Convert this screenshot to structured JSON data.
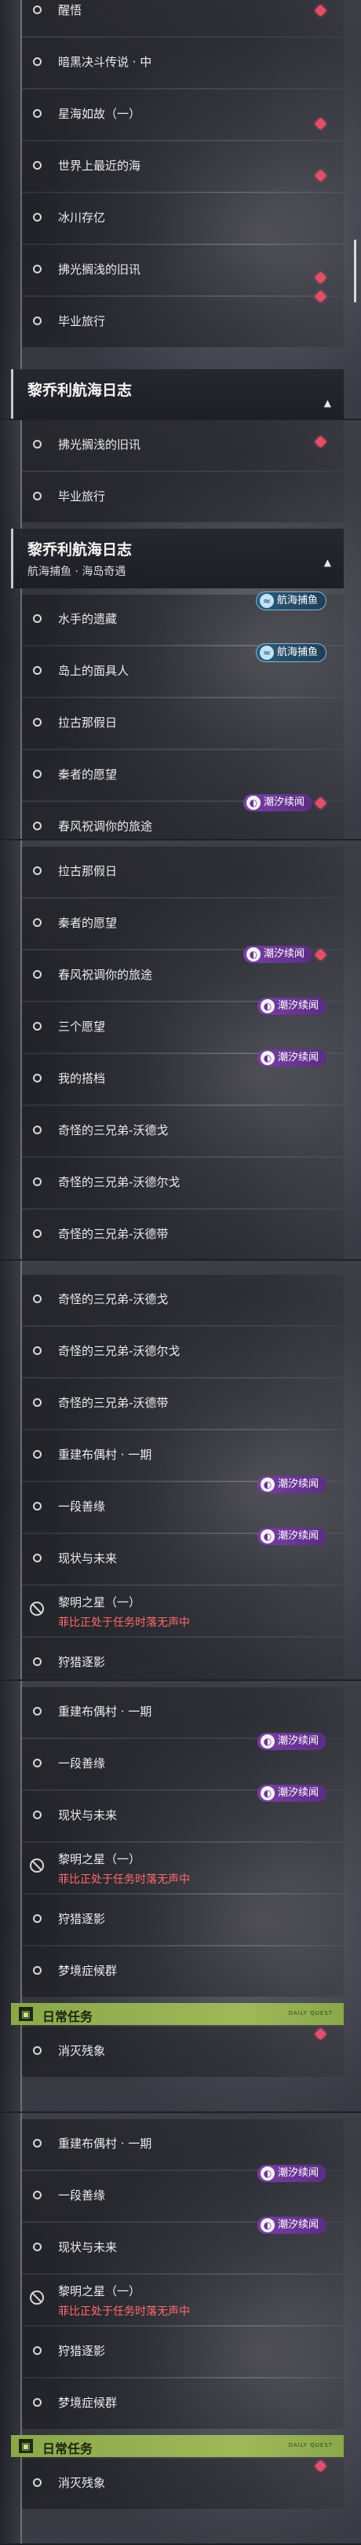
{
  "s1": {
    "items": [
      {
        "label": "醒悟",
        "dot": true
      },
      {
        "label": "暗黑决斗传说 · 中",
        "dot": false
      },
      {
        "label": "星海如故（一）",
        "dot": true
      },
      {
        "label": "世界上最近的海",
        "dot": true
      },
      {
        "label": "冰川存亿",
        "dot": false
      },
      {
        "label": "拂光搁浅的旧讯",
        "dot": true
      },
      {
        "label": "毕业旅行",
        "dot": false
      }
    ],
    "header": {
      "title": "黎乔利航海日志"
    }
  },
  "s2": {
    "items": [
      {
        "label": "拂光搁浅的旧讯",
        "dot": true
      },
      {
        "label": "毕业旅行",
        "dot": false
      }
    ],
    "header": {
      "title": "黎乔利航海日志",
      "sub": "航海捕鱼 · 海岛奇遇"
    },
    "items2": [
      {
        "label": "水手的遗藏",
        "tag": "航海捕鱼"
      },
      {
        "label": "岛上的面具人",
        "tag": "航海捕鱼"
      },
      {
        "label": "拉古那假日"
      },
      {
        "label": "秦者的愿望"
      },
      {
        "label": "春风祝调你的旅途",
        "tag": "潮汐续闻",
        "dot": true
      }
    ]
  },
  "s3": {
    "items": [
      {
        "label": "拉古那假日"
      },
      {
        "label": "秦者的愿望"
      },
      {
        "label": "春风祝调你的旅途",
        "tag": "潮汐续闻",
        "dot": true
      },
      {
        "label": "三个愿望",
        "tag": "潮汐续闻"
      },
      {
        "label": "我的搭档",
        "tag": "潮汐续闻"
      },
      {
        "label": "奇怪的三兄弟-沃德戈"
      },
      {
        "label": "奇怪的三兄弟-沃德尔戈"
      },
      {
        "label": "奇怪的三兄弟-沃德带"
      }
    ]
  },
  "s4": {
    "items": [
      {
        "label": "奇怪的三兄弟-沃德戈"
      },
      {
        "label": "奇怪的三兄弟-沃德尔戈"
      },
      {
        "label": "奇怪的三兄弟-沃德带"
      },
      {
        "label": "重建布偶村 · 一期"
      },
      {
        "label": "一段善缘",
        "tag": "潮汐续闻"
      },
      {
        "label": "现状与未来",
        "tag": "潮汐续闻"
      },
      {
        "label": "黎明之星（一）",
        "sub": "菲比正处于任务时落无声中"
      },
      {
        "label": "狩猎逐影"
      }
    ]
  },
  "s5": {
    "items": [
      {
        "label": "重建布偶村 · 一期"
      },
      {
        "label": "一段善缘",
        "tag": "潮汐续闻"
      },
      {
        "label": "现状与未来",
        "tag": "潮汐续闻"
      },
      {
        "label": "黎明之星（一）",
        "sub": "菲比正处于任务时落无声中"
      },
      {
        "label": "狩猎逐影"
      },
      {
        "label": "梦境症候群"
      }
    ],
    "daily": {
      "label": "日常任务",
      "small": "DAILY QUEST"
    },
    "after": [
      {
        "label": "消灭残象",
        "dot": true
      }
    ]
  },
  "s6": {
    "items": [
      {
        "label": "重建布偶村 · 一期"
      },
      {
        "label": "一段善缘",
        "tag": "潮汐续闻"
      },
      {
        "label": "现状与未来",
        "tag": "潮汐续闻"
      },
      {
        "label": "黎明之星（一）",
        "sub": "菲比正处于任务时落无声中"
      },
      {
        "label": "狩猎逐影"
      },
      {
        "label": "梦境症候群"
      }
    ],
    "daily": {
      "label": "日常任务",
      "small": "DAILY QUEST"
    },
    "after": [
      {
        "label": "消灭残象",
        "dot": true
      }
    ]
  },
  "colors": {
    "dot": "#e0506a",
    "tag": "#6a338f",
    "daily": "#9fb858",
    "warn": "#ff6a6a"
  }
}
